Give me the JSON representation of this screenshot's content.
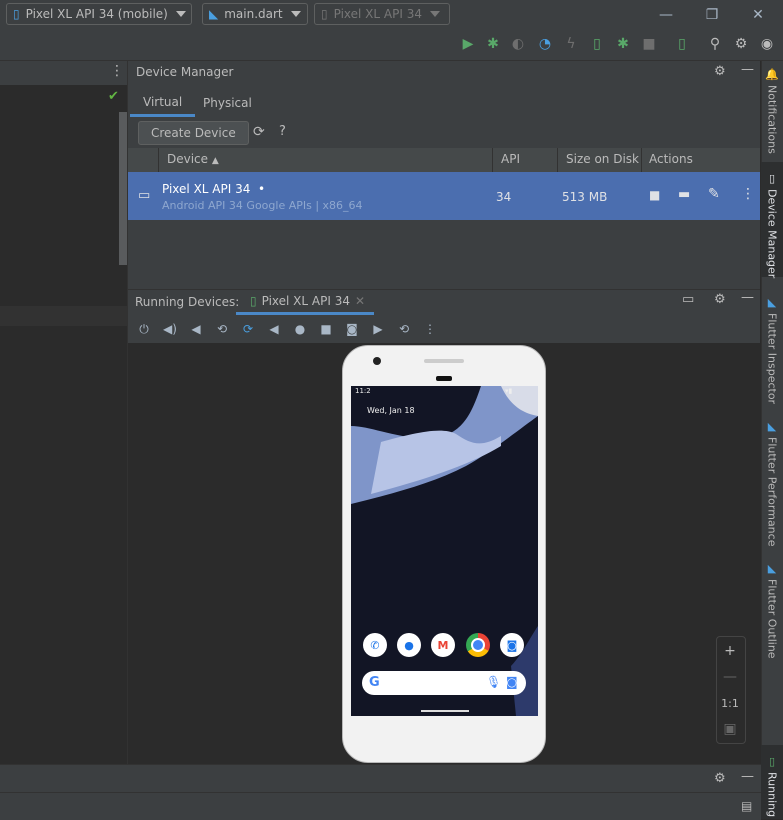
{
  "window": {
    "minimize": "—",
    "restore": "❐",
    "close": "✕"
  },
  "toolbar": {
    "device_target": "Pixel XL API 34 (mobile)",
    "run_config": "main.dart",
    "disabled_target": "Pixel XL API 34"
  },
  "device_manager": {
    "title": "Device Manager",
    "tabs": [
      "Virtual",
      "Physical"
    ],
    "create_button": "Create Device",
    "help": "?",
    "columns": {
      "device": "Device",
      "api": "API",
      "size": "Size on Disk",
      "actions": "Actions"
    },
    "rows": [
      {
        "name": "Pixel XL API 34",
        "running_dot": "•",
        "subtitle": "Android API 34 Google APIs | x86_64",
        "api": "34",
        "size": "513 MB"
      }
    ]
  },
  "running_devices": {
    "title": "Running Devices:",
    "tab": "Pixel XL API 34"
  },
  "phone": {
    "status_time": "11:2",
    "date": "Wed, Jan 18"
  },
  "zoom": {
    "plus": "+",
    "minus": "—",
    "actual": "1:1"
  },
  "right_strip": {
    "notifications": "Notifications",
    "device_manager": "Device Manager",
    "flutter_inspector": "Flutter Inspector",
    "flutter_performance": "Flutter Performance",
    "flutter_outline": "Flutter Outline",
    "running": "Running"
  },
  "colors": {
    "accent": "#4a88c7",
    "selection": "#4b6eaf",
    "run_green": "#59a869",
    "check_green": "#62b543"
  }
}
